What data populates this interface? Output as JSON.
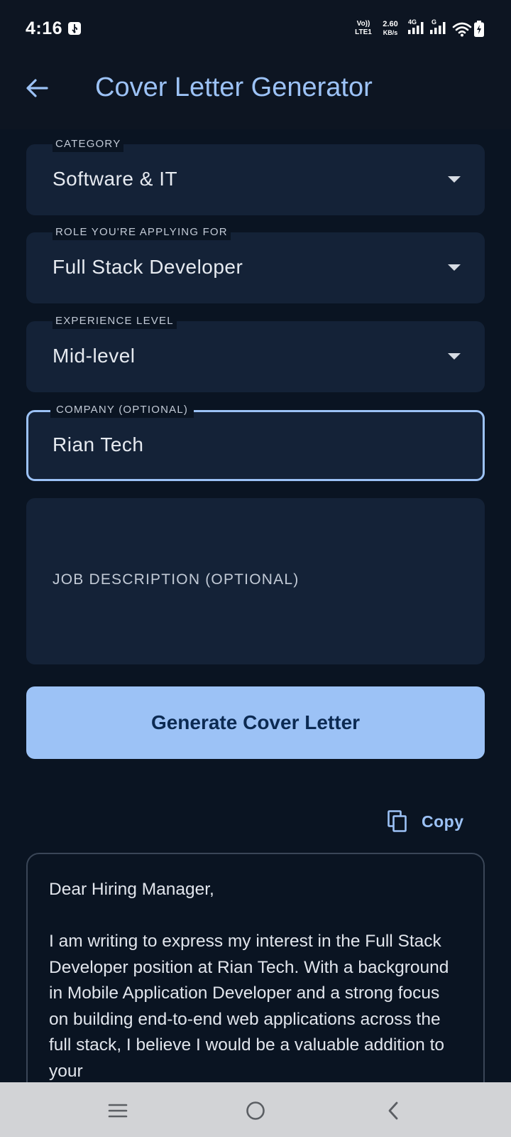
{
  "status_bar": {
    "time": "4:16",
    "volte_top": "Vo))",
    "volte_bottom": "LTE1",
    "speed_value": "2.60",
    "speed_unit": "KB/s",
    "sim1_network": "4G",
    "sim2_network": "G"
  },
  "header": {
    "title": "Cover Letter Generator"
  },
  "form": {
    "category": {
      "label": "CATEGORY",
      "value": "Software & IT"
    },
    "role": {
      "label": "ROLE YOU'RE APPLYING FOR",
      "value": "Full Stack Developer"
    },
    "experience": {
      "label": "EXPERIENCE LEVEL",
      "value": "Mid-level"
    },
    "company": {
      "label": "COMPANY (OPTIONAL)",
      "value": "Rian Tech"
    },
    "job_description": {
      "placeholder": "JOB DESCRIPTION (OPTIONAL)"
    }
  },
  "actions": {
    "generate_label": "Generate Cover Letter",
    "copy_label": "Copy"
  },
  "letter": {
    "greeting": "Dear Hiring Manager,",
    "body": "I am writing to express my interest in the Full Stack Developer position at Rian Tech. With a background in Mobile Application Developer and a strong focus on building end-to-end web applications across the full stack, I believe I would be a valuable addition to your"
  },
  "colors": {
    "background": "#0a1422",
    "field_bg": "#142237",
    "accent": "#9cc2f6",
    "button_text": "#0c2a52",
    "nav_bar": "#d2d3d6"
  },
  "icons": {
    "back": "arrow-left-icon",
    "dropdown": "caret-down-icon",
    "copy": "copy-icon",
    "nav_menu": "menu-lines-icon",
    "nav_home": "circle-home-icon",
    "nav_back": "chevron-left-icon"
  }
}
